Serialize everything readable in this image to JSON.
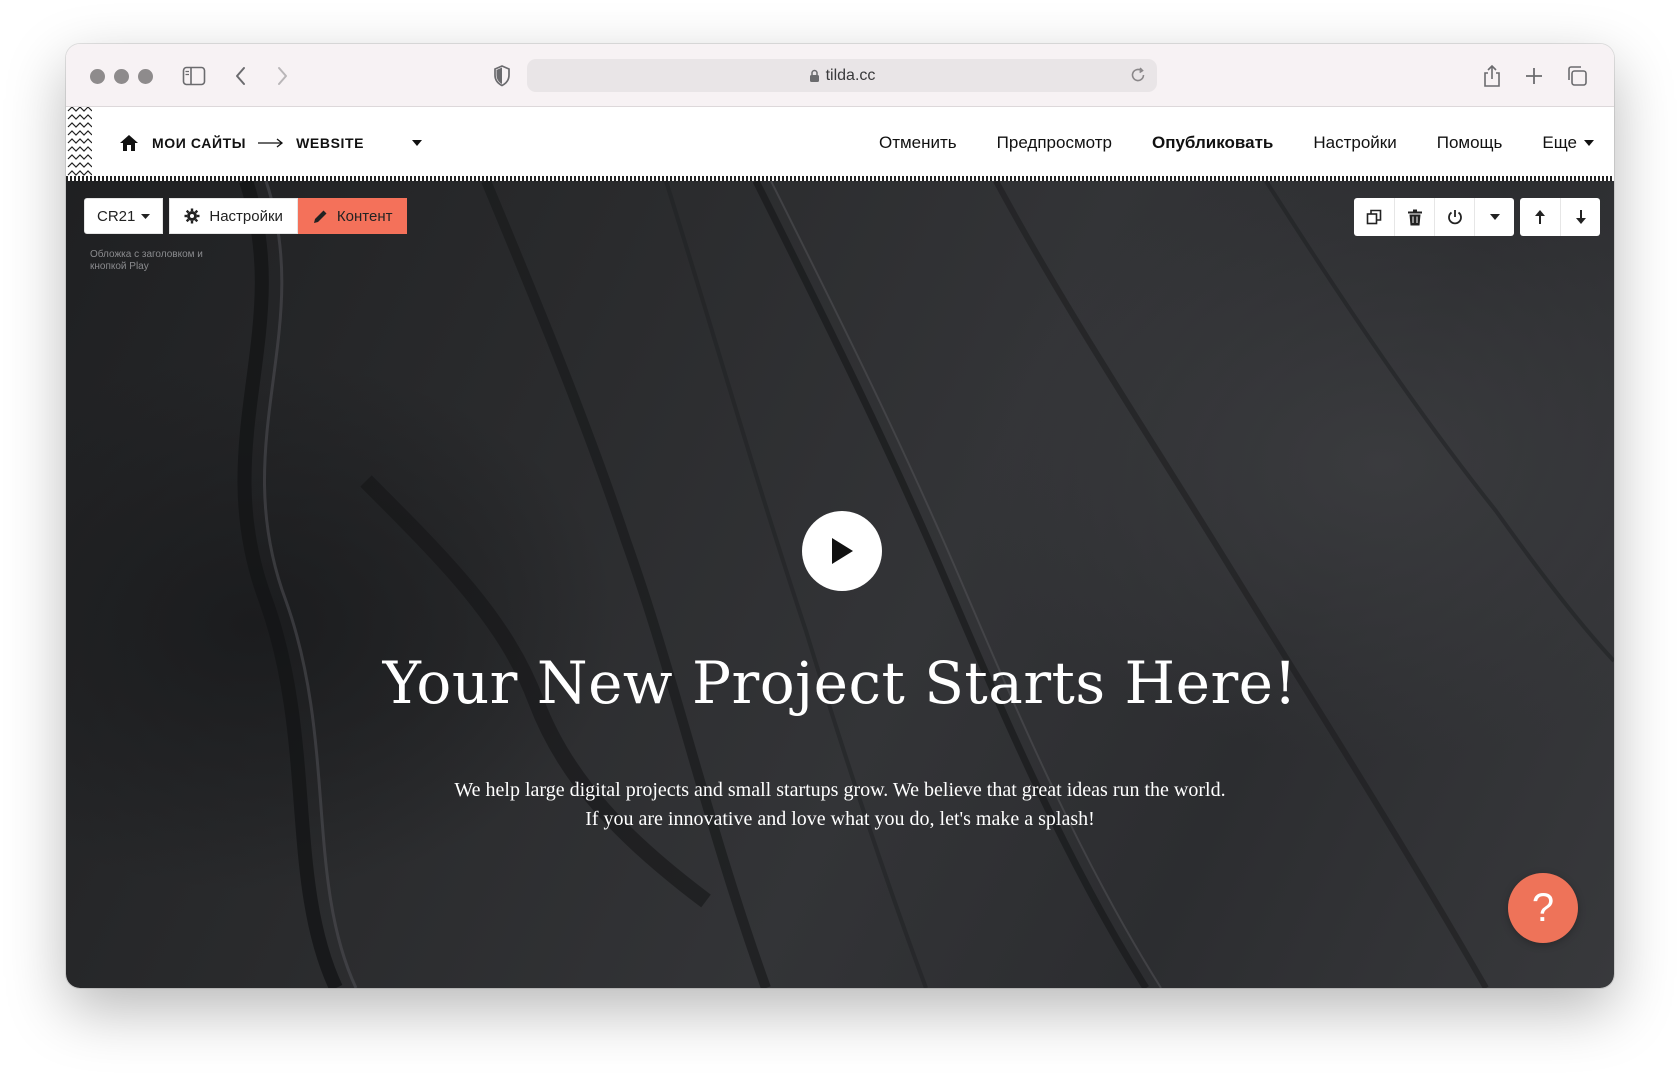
{
  "browser": {
    "url": "tilda.cc",
    "icons": [
      "sidebar-icon",
      "back-icon",
      "forward-icon",
      "shield-icon",
      "lock-icon",
      "reload-icon",
      "share-icon",
      "plus-icon",
      "tabs-icon"
    ]
  },
  "editor": {
    "breadcrumb": {
      "root": "МОИ САЙТЫ",
      "project": "WEBSITE"
    },
    "nav": {
      "undo": "Отменить",
      "preview": "Предпросмотр",
      "publish": "Опубликовать",
      "settings": "Настройки",
      "help": "Помощь",
      "more": "Еще"
    }
  },
  "block": {
    "code": "CR21",
    "settings_label": "Настройки",
    "content_label": "Контент",
    "description": "Обложка с заголовком и кнопкой Play",
    "accent_color": "#f4715a"
  },
  "hero": {
    "title": "Your New Project Starts Here!",
    "text_line1": "We help large digital projects and small startups grow. We believe that great ideas run the world.",
    "text_line2": "If you are innovative and love what you do, let's make a splash!"
  },
  "help_button": {
    "label": "?",
    "color": "#ee7359"
  }
}
